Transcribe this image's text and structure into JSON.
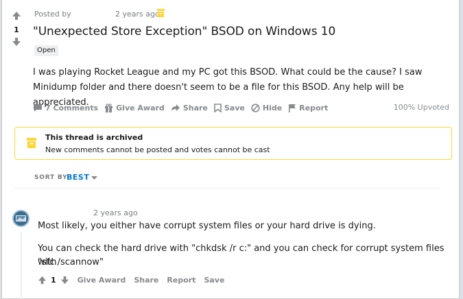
{
  "post": {
    "posted_by_label": "Posted by",
    "time": "2 years ago",
    "vote_count": "1",
    "title": "\"Unexpected Store Exception\" BSOD on Windows 10",
    "flair": "Open",
    "body": "I was playing Rocket League and my PC got this BSOD. What could be the cause? I saw Minidump folder and there doesn't seem to be a file for this BSOD. Any help will be appreciated.",
    "actions": {
      "comments": "7 Comments",
      "give_award": "Give Award",
      "share": "Share",
      "save": "Save",
      "hide": "Hide",
      "report": "Report"
    },
    "upvoted": "100% Upvoted"
  },
  "archive": {
    "title": "This thread is archived",
    "subtitle": "New comments cannot be posted and votes cannot be cast"
  },
  "sort": {
    "label": "SORT BY",
    "value": "BEST"
  },
  "comment": {
    "time": "2 years ago",
    "paragraph1": "Most likely, you either have corrupt system files or your hard drive is dying.",
    "paragraph2_line1": "You can check the hard drive with \"chkdsk /r c:\" and you can check for corrupt system files with",
    "paragraph2_line2": "\"sfc /scannow\"",
    "vote_count": "1",
    "actions": {
      "give_award": "Give Award",
      "share": "Share",
      "report": "Report",
      "save": "Save"
    }
  },
  "colors": {
    "archive_accent": "#ffd635",
    "link_blue": "#0079d3",
    "muted_text": "#878a8c"
  }
}
